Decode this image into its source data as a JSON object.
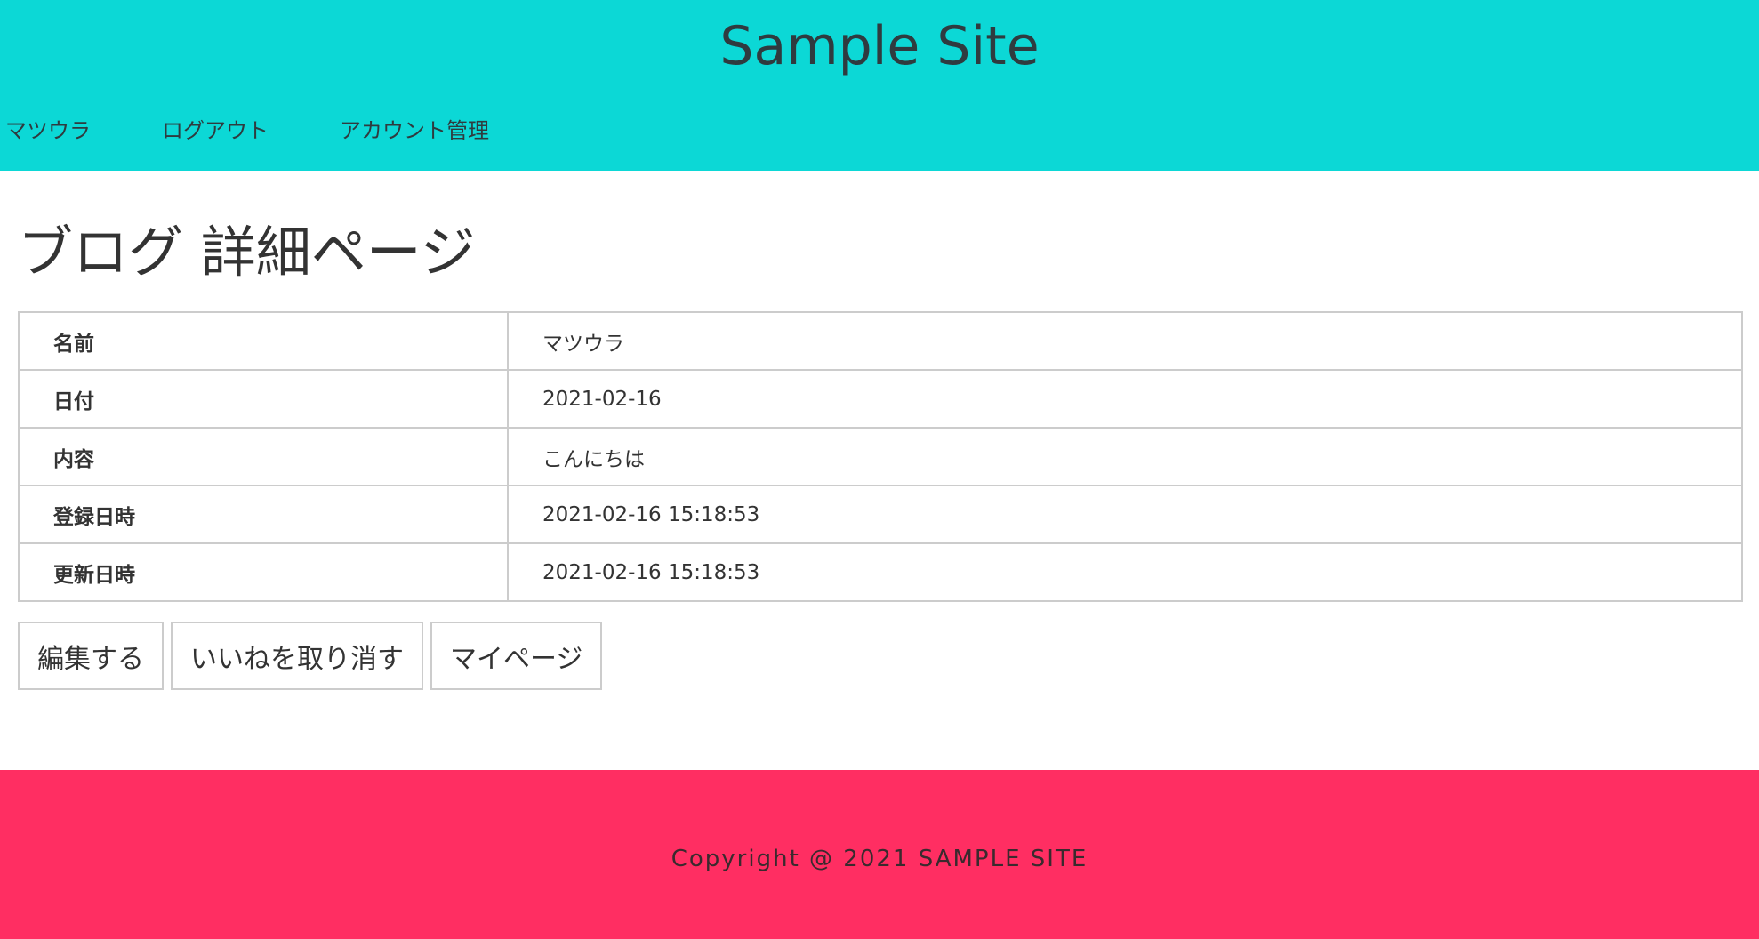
{
  "header": {
    "site_title": "Sample Site",
    "nav": [
      {
        "label": "マツウラ"
      },
      {
        "label": "ログアウト"
      },
      {
        "label": "アカウント管理"
      }
    ]
  },
  "main": {
    "page_title": "ブログ 詳細ページ",
    "rows": [
      {
        "label": "名前",
        "value": "マツウラ"
      },
      {
        "label": "日付",
        "value": "2021-02-16"
      },
      {
        "label": "内容",
        "value": "こんにちは"
      },
      {
        "label": "登録日時",
        "value": "2021-02-16 15:18:53"
      },
      {
        "label": "更新日時",
        "value": "2021-02-16 15:18:53"
      }
    ],
    "buttons": {
      "edit": "編集する",
      "unlike": "いいねを取り消す",
      "mypage": "マイページ"
    }
  },
  "footer": {
    "copyright": "Copyright @ 2021 SAMPLE SITE"
  },
  "colors": {
    "header_bg": "#0cd8d6",
    "footer_bg": "#ff2e62",
    "border": "#cccccc"
  }
}
